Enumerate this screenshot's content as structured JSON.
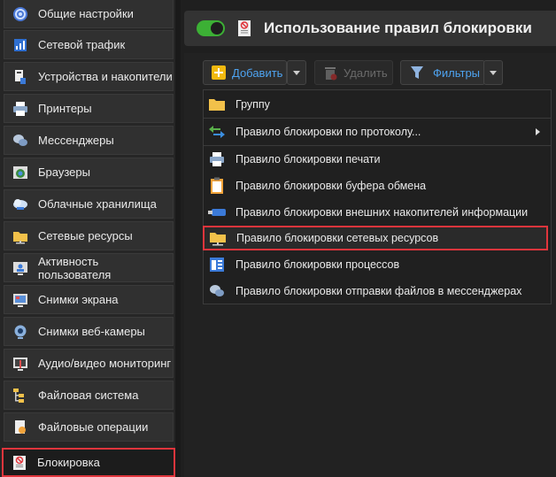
{
  "sidebar": {
    "items": [
      {
        "label": "Общие настройки",
        "icon": "gear-icon"
      },
      {
        "label": "Сетевой трафик",
        "icon": "network-traffic-icon"
      },
      {
        "label": "Устройства и накопители",
        "icon": "devices-icon"
      },
      {
        "label": "Принтеры",
        "icon": "printer-icon"
      },
      {
        "label": "Мессенджеры",
        "icon": "messenger-icon"
      },
      {
        "label": "Браузеры",
        "icon": "browser-icon"
      },
      {
        "label": "Облачные хранилища",
        "icon": "cloud-icon"
      },
      {
        "label": "Сетевые ресурсы",
        "icon": "network-folder-icon"
      },
      {
        "label": "Активность пользователя",
        "icon": "user-activity-icon"
      },
      {
        "label": "Снимки экрана",
        "icon": "screenshot-icon"
      },
      {
        "label": "Снимки веб-камеры",
        "icon": "webcam-icon"
      },
      {
        "label": "Аудио/видео мониторинг",
        "icon": "av-monitoring-icon"
      },
      {
        "label": "Файловая система",
        "icon": "file-system-icon"
      },
      {
        "label": "Файловые операции",
        "icon": "file-operations-icon"
      },
      {
        "label": "Блокировка",
        "icon": "block-icon"
      }
    ]
  },
  "header": {
    "title": "Использование правил блокировки",
    "toggle_on": true
  },
  "toolbar": {
    "add_label": "Добавить",
    "delete_label": "Удалить",
    "filters_label": "Фильтры"
  },
  "dropdown": {
    "items": [
      {
        "label": "Группу",
        "icon": "folder-icon"
      },
      {
        "label": "Правило блокировки по протоколу...",
        "icon": "protocol-arrows-icon",
        "submenu": true
      },
      {
        "label": "Правило блокировки печати",
        "icon": "printer-icon"
      },
      {
        "label": "Правило блокировки буфера обмена",
        "icon": "clipboard-icon"
      },
      {
        "label": "Правило блокировки внешних накопителей информации",
        "icon": "usb-drive-icon"
      },
      {
        "label": "Правило блокировки сетевых ресурсов",
        "icon": "network-folder-icon"
      },
      {
        "label": "Правило блокировки процессов",
        "icon": "process-window-icon"
      },
      {
        "label": "Правило блокировки отправки файлов в мессенджерах",
        "icon": "messenger-icon"
      }
    ]
  },
  "colors": {
    "accent_red": "#e0353c",
    "toggle_green": "#3cb035",
    "add_yellow": "#f2b90f"
  }
}
